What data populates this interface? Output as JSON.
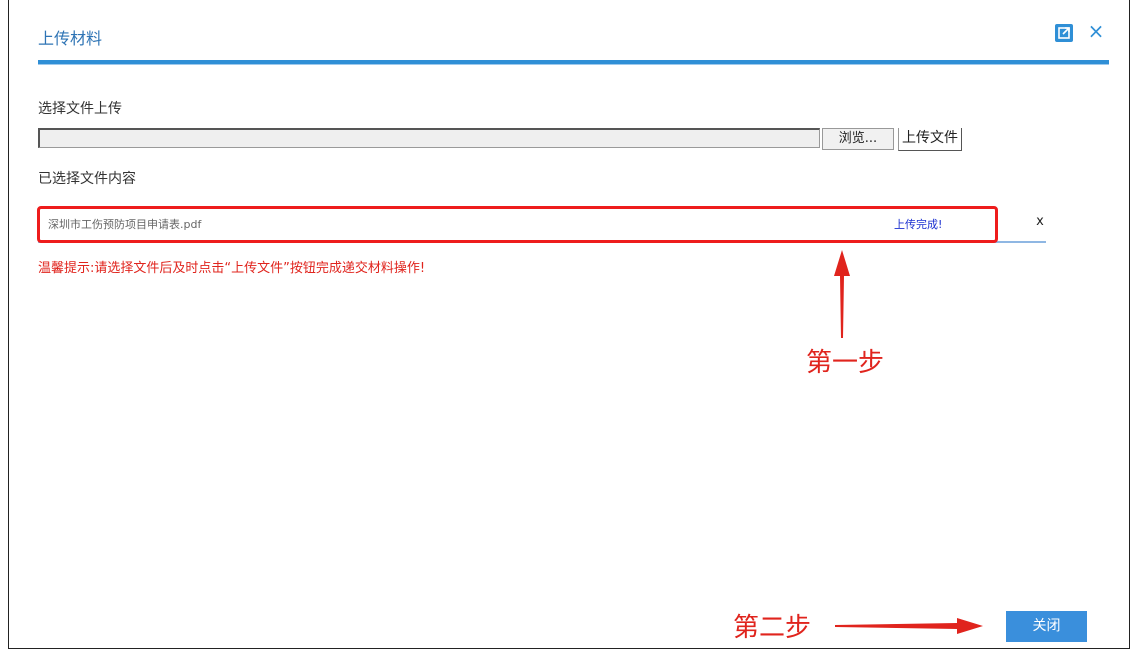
{
  "dialog": {
    "title": "上传材料",
    "popout_icon": "popout-icon",
    "close_icon": "close-icon",
    "close_glyph": "×"
  },
  "upload": {
    "select_label": "选择文件上传",
    "file_input_value": "",
    "browse_label": "浏览...",
    "upload_label": "上传文件",
    "selected_label": "已选择文件内容"
  },
  "files": [
    {
      "name": "深圳市工伤预防项目申请表.pdf",
      "status": "上传完成!",
      "remove": "x"
    }
  ],
  "tip": "温馨提示:请选择文件后及时点击“上传文件”按钮完成递交材料操作!",
  "annotations": {
    "step1": "第一步",
    "step2": "第二步"
  },
  "footer": {
    "close_label": "关闭"
  },
  "colors": {
    "accent": "#2f8fd6",
    "annotation_red": "#e0241d",
    "status_blue": "#1a2fd0"
  }
}
